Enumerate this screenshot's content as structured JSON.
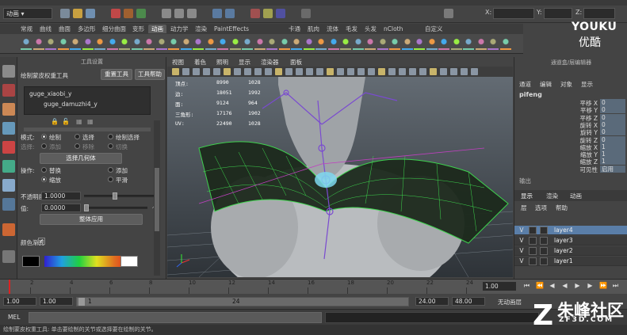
{
  "status_line": {
    "mode": "动画",
    "x_label": "X:",
    "y_label": "Y:",
    "z_label": "Z:"
  },
  "shelf_tabs": [
    "常规",
    "曲线",
    "曲面",
    "多边形",
    "细分曲面",
    "变形",
    "动画",
    "动力学",
    "渲染",
    "PaintEffects",
    "卡通",
    "肌肉",
    "流体",
    "毛发",
    "头发",
    "nCloth",
    "自定义"
  ],
  "shelf_active_tab": "动画",
  "tool_settings": {
    "header": "工具设置",
    "tool_name": "绘制蒙皮权重工具",
    "reset_button": "重置工具",
    "help_button": "工具帮助",
    "influence_list": [
      "guge_xiaobi_y",
      "guge_damuzhi4_y"
    ],
    "mode_label": "模式:",
    "mode_options": [
      "绘制",
      "选择",
      "绘制选择"
    ],
    "mode_selected": "绘制",
    "select_label": "选择:",
    "select_options": [
      "添加",
      "移除",
      "切换"
    ],
    "select_geometry_button": "选择几何体",
    "operation_label": "操作:",
    "operation_options": [
      "替换",
      "添加",
      "缩放",
      "平滑"
    ],
    "operation_selected": "缩放",
    "opacity_label": "不透明度:",
    "opacity_value": "1.0000",
    "value_label": "值:",
    "value_value": "0.0000",
    "flood_button": "整体应用",
    "gradient_label": "颜色渐变",
    "opacity_fraction": 0.42,
    "value_fraction": 0.0
  },
  "viewport": {
    "menu": [
      "视图",
      "着色",
      "照明",
      "显示",
      "渲染器",
      "面板"
    ],
    "hud": [
      {
        "label": "顶点:",
        "a": "8990",
        "b": "1028"
      },
      {
        "label": "边:",
        "a": "18051",
        "b": "1992"
      },
      {
        "label": "面:",
        "a": "9124",
        "b": "964"
      },
      {
        "label": "三角形:",
        "a": "17176",
        "b": "1902"
      },
      {
        "label": "UV:",
        "a": "22490",
        "b": "1028"
      }
    ],
    "character_name": "pifeng"
  },
  "channel_box": {
    "header": "通道盒/层编辑器",
    "menu": [
      "通道",
      "编辑",
      "对象",
      "显示"
    ],
    "object_name": "pifeng",
    "attributes": [
      {
        "name": "平移 X",
        "value": "0"
      },
      {
        "name": "平移 Y",
        "value": "0"
      },
      {
        "name": "平移 Z",
        "value": "0"
      },
      {
        "name": "旋转 X",
        "value": "0"
      },
      {
        "name": "旋转 Y",
        "value": "0"
      },
      {
        "name": "旋转 Z",
        "value": "0"
      },
      {
        "name": "缩放 X",
        "value": "1"
      },
      {
        "name": "缩放 Y",
        "value": "1"
      },
      {
        "name": "缩放 Z",
        "value": "1"
      },
      {
        "name": "可见性",
        "value": "启用"
      }
    ],
    "shapes_label": "输出",
    "layer_tabs": [
      "显示",
      "渲染",
      "动画"
    ],
    "layer_menu": [
      "层",
      "选项",
      "帮助"
    ],
    "layers": [
      {
        "v": "V",
        "name": "layer4",
        "selected": true
      },
      {
        "v": "V",
        "name": "layer3",
        "selected": false
      },
      {
        "v": "V",
        "name": "layer2",
        "selected": false
      },
      {
        "v": "V",
        "name": "layer1",
        "selected": false
      }
    ]
  },
  "timeline": {
    "ticks": [
      "2",
      "4",
      "6",
      "8",
      "10",
      "12",
      "14",
      "16",
      "18",
      "20",
      "22",
      "24"
    ],
    "current_frame": "1.00"
  },
  "range": {
    "start": "1.00",
    "start_inner": "1.00",
    "slider_start": "1",
    "slider_end": "24",
    "end_inner": "24.00",
    "end": "48.00",
    "anim_layer": "无动画层"
  },
  "command": {
    "lang": "MEL"
  },
  "help_line": "绘制蒙皮权重工具: 单击要绘制的关节或选择要在绘制的关节。",
  "watermarks": {
    "top": "YOUKU",
    "top_sub": "优酷",
    "bottom": "朱峰社区",
    "bottom_sub": "ZF3D.COM"
  }
}
